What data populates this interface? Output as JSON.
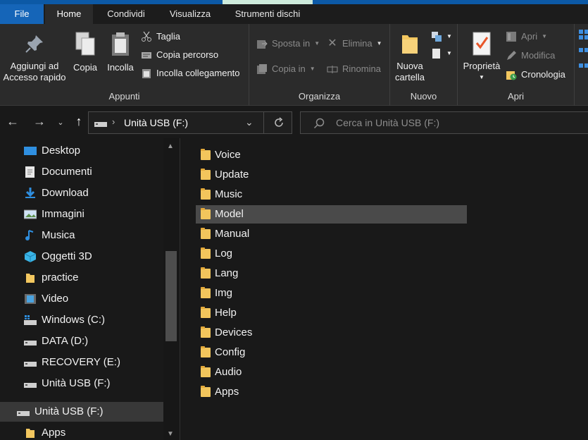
{
  "tabs": {
    "file": "File",
    "home": "Home",
    "share": "Condividi",
    "view": "Visualizza",
    "disk_tools": "Strumenti dischi"
  },
  "ribbon": {
    "clipboard": {
      "label": "Appunti",
      "pin": "Aggiungi ad Accesso rapido",
      "pin_l1": "Aggiungi ad",
      "pin_l2": "Accesso rapido",
      "copy": "Copia",
      "paste": "Incolla",
      "cut": "Taglia",
      "copy_path": "Copia percorso",
      "paste_shortcut": "Incolla collegamento"
    },
    "organize": {
      "label": "Organizza",
      "move_to": "Sposta in",
      "copy_to": "Copia in",
      "delete": "Elimina",
      "rename": "Rinomina"
    },
    "new": {
      "label": "Nuovo",
      "new_folder_l1": "Nuova",
      "new_folder_l2": "cartella"
    },
    "open": {
      "label": "Apri",
      "properties": "Proprietà",
      "open": "Apri",
      "edit": "Modifica",
      "history": "Cronologia"
    }
  },
  "address": {
    "path": "Unità USB (F:)",
    "search_placeholder": "Cerca in Unità USB (F:)"
  },
  "nav_pane": [
    {
      "label": "Desktop",
      "icon": "desktop-icon"
    },
    {
      "label": "Documenti",
      "icon": "documents-icon"
    },
    {
      "label": "Download",
      "icon": "download-icon"
    },
    {
      "label": "Immagini",
      "icon": "pictures-icon"
    },
    {
      "label": "Musica",
      "icon": "music-icon"
    },
    {
      "label": "Oggetti 3D",
      "icon": "3d-objects-icon"
    },
    {
      "label": "practice",
      "icon": "folder-icon"
    },
    {
      "label": "Video",
      "icon": "video-icon"
    },
    {
      "label": "Windows (C:)",
      "icon": "windows-drive-icon"
    },
    {
      "label": "DATA (D:)",
      "icon": "drive-icon"
    },
    {
      "label": "RECOVERY (E:)",
      "icon": "drive-icon"
    },
    {
      "label": "Unità USB (F:)",
      "icon": "usb-drive-icon"
    },
    {
      "label": "Unità USB (F:)",
      "icon": "usb-drive-icon"
    },
    {
      "label": "Apps",
      "icon": "folder-icon"
    }
  ],
  "files": [
    "Voice",
    "Update",
    "Music",
    "Model",
    "Manual",
    "Log",
    "Lang",
    "Img",
    "Help",
    "Devices",
    "Config",
    "Audio",
    "Apps"
  ],
  "selected_file": "Model"
}
